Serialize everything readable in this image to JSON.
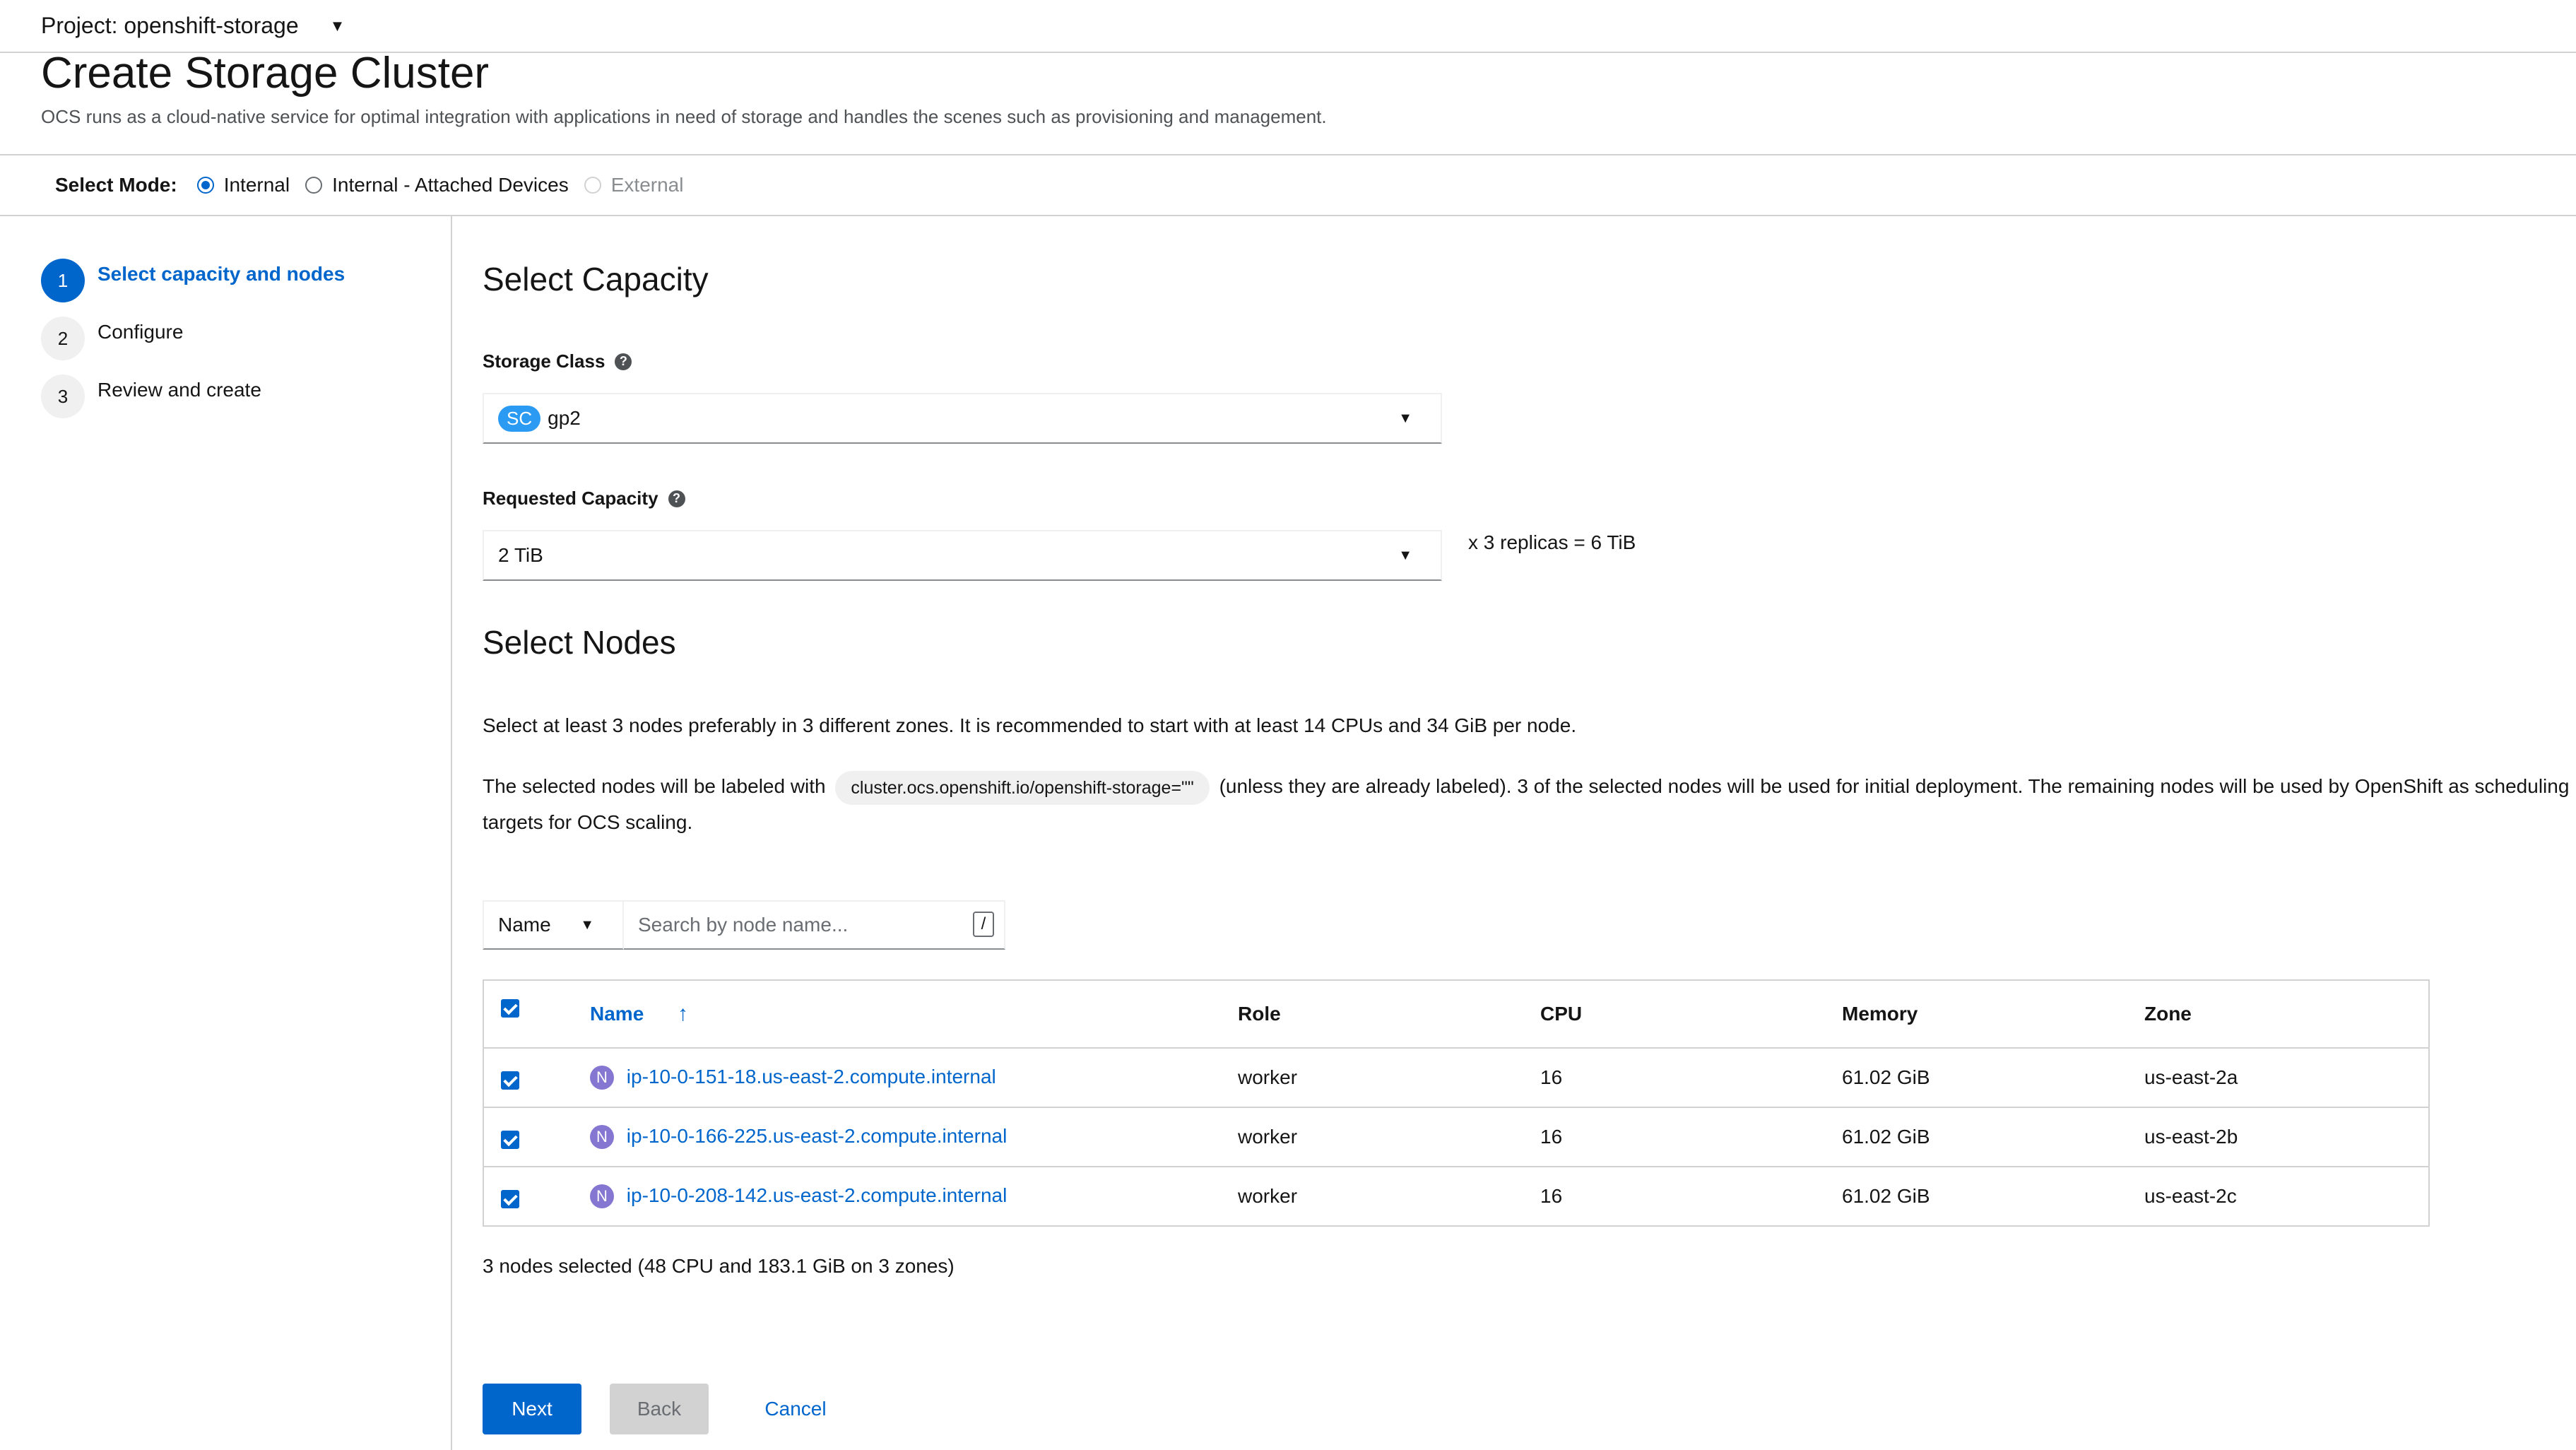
{
  "project": {
    "label": "Project: openshift-storage"
  },
  "page": {
    "title": "Create Storage Cluster",
    "description": "OCS runs as a cloud-native service for optimal integration with applications in need of storage and handles the scenes such as provisioning and management."
  },
  "mode": {
    "label": "Select Mode:",
    "options": [
      {
        "label": "Internal",
        "selected": true,
        "disabled": false
      },
      {
        "label": "Internal - Attached Devices",
        "selected": false,
        "disabled": false
      },
      {
        "label": "External",
        "selected": false,
        "disabled": true
      }
    ]
  },
  "wizard": {
    "steps": [
      {
        "num": "1",
        "label": "Select capacity and nodes",
        "active": true
      },
      {
        "num": "2",
        "label": "Configure",
        "active": false
      },
      {
        "num": "3",
        "label": "Review and create",
        "active": false
      }
    ]
  },
  "capacity": {
    "title": "Select Capacity",
    "storage_class_label": "Storage Class",
    "storage_class_badge": "SC",
    "storage_class_value": "gp2",
    "requested_capacity_label": "Requested Capacity",
    "requested_capacity_value": "2 TiB",
    "replica_text": "x 3 replicas = 6 TiB"
  },
  "nodes": {
    "title": "Select Nodes",
    "intro": "Select at least 3 nodes preferably in 3 different zones. It is recommended to start with at least 14 CPUs and 34 GiB per node.",
    "label_text_before": "The selected nodes will be labeled with",
    "label_chip": "cluster.ocs.openshift.io/openshift-storage=\"\"",
    "label_text_after": "(unless they are already labeled). 3 of the selected nodes will be used for initial deployment. The remaining nodes will be used by OpenShift as scheduling targets for OCS scaling.",
    "filter": {
      "dropdown_value": "Name",
      "search_placeholder": "Search by node name...",
      "shortcut_key": "/"
    },
    "table": {
      "columns": [
        "Name",
        "Role",
        "CPU",
        "Memory",
        "Zone"
      ],
      "rows": [
        {
          "badge": "N",
          "name": "ip-10-0-151-18.us-east-2.compute.internal",
          "role": "worker",
          "cpu": "16",
          "memory": "61.02 GiB",
          "zone": "us-east-2a"
        },
        {
          "badge": "N",
          "name": "ip-10-0-166-225.us-east-2.compute.internal",
          "role": "worker",
          "cpu": "16",
          "memory": "61.02 GiB",
          "zone": "us-east-2b"
        },
        {
          "badge": "N",
          "name": "ip-10-0-208-142.us-east-2.compute.internal",
          "role": "worker",
          "cpu": "16",
          "memory": "61.02 GiB",
          "zone": "us-east-2c"
        }
      ]
    },
    "summary": "3 nodes selected (48 CPU and 183.1 GiB on 3 zones)"
  },
  "actions": {
    "next": "Next",
    "back": "Back",
    "cancel": "Cancel"
  },
  "colors": {
    "accent": "#0066cc",
    "node_badge": "#8476d1",
    "sc_badge": "#2b9af3"
  }
}
